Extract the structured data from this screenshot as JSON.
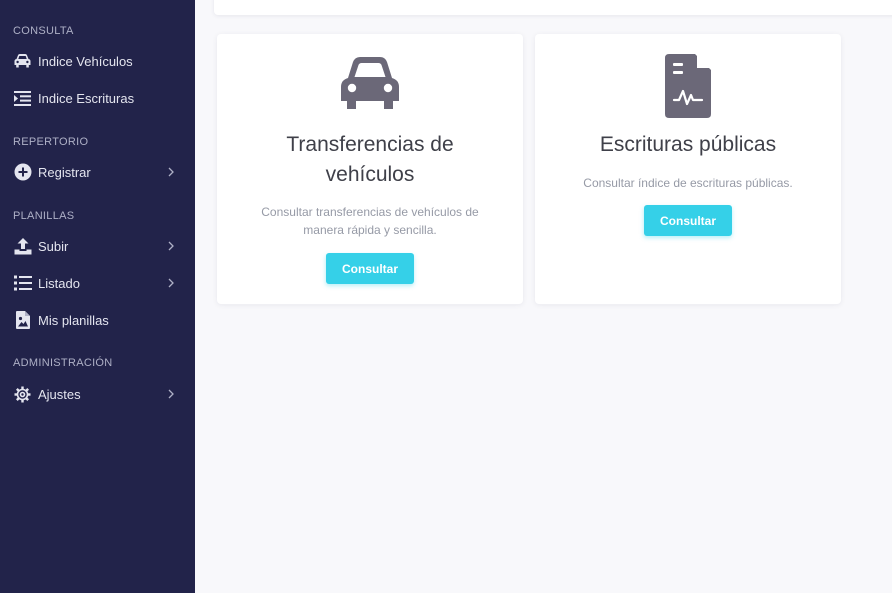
{
  "sidebar": {
    "sections": [
      {
        "title": "CONSULTA",
        "items": [
          {
            "label": "Indice Vehículos",
            "icon": "car-icon"
          },
          {
            "label": "Indice Escrituras",
            "icon": "indent-list-icon"
          }
        ]
      },
      {
        "title": "REPERTORIO",
        "items": [
          {
            "label": "Registrar",
            "icon": "plus-circle-icon"
          }
        ]
      },
      {
        "title": "PLANILLAS",
        "items": [
          {
            "label": "Subir",
            "icon": "upload-icon"
          },
          {
            "label": "Listado",
            "icon": "list-icon"
          },
          {
            "label": "Mis planillas",
            "icon": "file-image-icon"
          }
        ]
      },
      {
        "title": "ADMINISTRACIÓN",
        "items": [
          {
            "label": "Ajustes",
            "icon": "gear-icon"
          }
        ]
      }
    ]
  },
  "cards": [
    {
      "title_line1": "Transferencias de",
      "title_line2": "vehículos",
      "description_line1": "Consultar transferencias de vehículos de",
      "description_line2": "manera rápida y sencilla.",
      "button_label": "Consultar",
      "icon": "car-icon"
    },
    {
      "title_line1": "Escrituras públicas",
      "description_line1": "Consultar índice de escrituras públicas.",
      "button_label": "Consultar",
      "icon": "file-signature-icon"
    }
  ],
  "colors": {
    "sidebar_bg": "#22234a",
    "accent": "#35d0e8",
    "icon_gray": "#6b6878",
    "page_bg": "#f8f8fb"
  }
}
